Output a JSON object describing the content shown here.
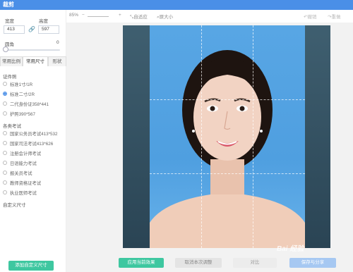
{
  "title": "裁剪",
  "left": {
    "width_label": "宽度",
    "height_label": "高度",
    "width_value": "413",
    "height_value": "597",
    "corner_label": "圆角",
    "corner_value": "0",
    "tabs": [
      "常用比例",
      "常用尺寸",
      "形状"
    ],
    "sections": [
      {
        "title": "证件照",
        "options": [
          "标准1寸/1R",
          "标准二寸/2R",
          "二代身份证358*441",
          "护照390*567"
        ]
      },
      {
        "title": "各类考试",
        "options": [
          "国家公务员考试413*532",
          "国家司法考试413*626",
          "注册会计师考试",
          "日语能力考试",
          "报关员考试",
          "教师资格证考试",
          "执业医师考试"
        ]
      }
    ],
    "custom_label": "自定义尺寸",
    "add_custom_button": "添加自定义尺寸"
  },
  "toolbar": {
    "zoom": "85%",
    "fit": "自适应",
    "original": "原大小",
    "undo": "撤销",
    "redo": "重做"
  },
  "bottom": {
    "apply": "应用当前效果",
    "cancel": "取消本次调整",
    "compare": "对比",
    "save": "保存与分享"
  },
  "watermark": "Bai 经验",
  "colors": {
    "accent": "#4a8fe7",
    "green": "#3ec7a0"
  }
}
